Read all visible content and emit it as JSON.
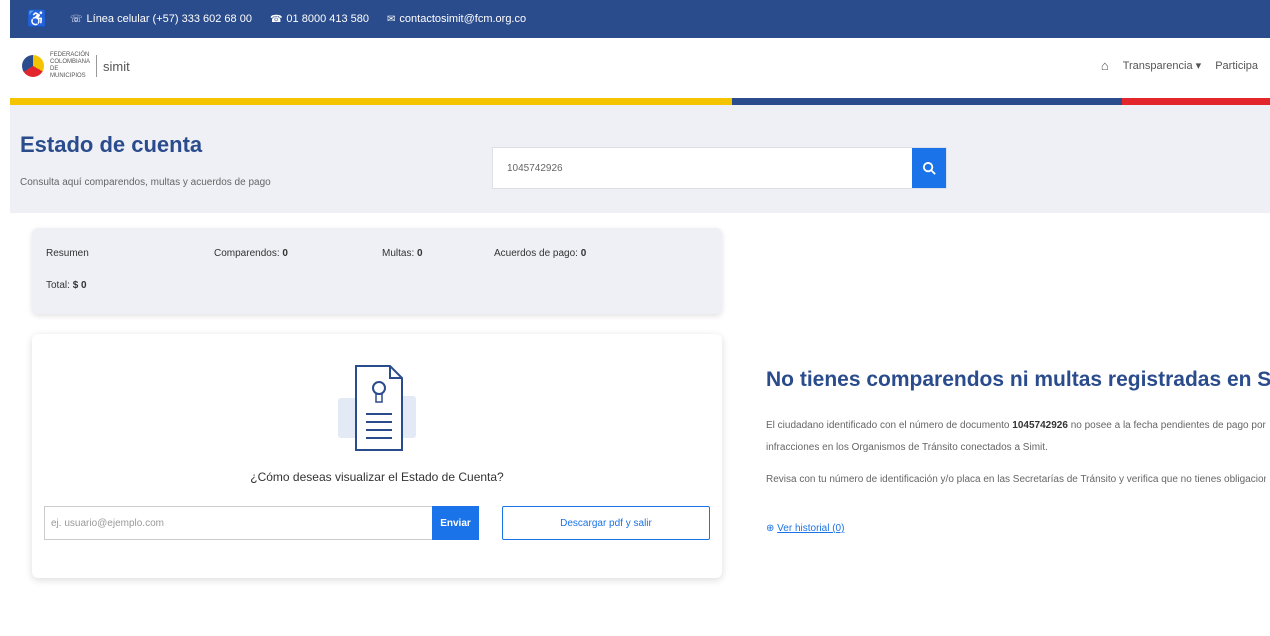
{
  "topbar": {
    "phone_label": "Línea celular (+57) 333 602 68 00",
    "landline": "01 8000 413 580",
    "email": "contactosimit@fcm.org.co"
  },
  "header": {
    "logo_text": "FEDERACIÓN COLOMBIANA DE MUNICIPIOS",
    "logo_app": "simit",
    "nav": [
      "Transparencia",
      "Participa"
    ]
  },
  "page": {
    "title": "Estado de cuenta",
    "subtitle": "Consulta aquí comparendos, multas y acuerdos de pago"
  },
  "search": {
    "value": "1045742926"
  },
  "summary": {
    "resumen_label": "Resumen",
    "comparendos_label": "Comparendos:",
    "comparendos_value": "0",
    "multas_label": "Multas:",
    "multas_value": "0",
    "acuerdos_label": "Acuerdos de pago:",
    "acuerdos_value": "0",
    "total_label": "Total:",
    "total_value": "$ 0"
  },
  "card": {
    "question": "¿Cómo deseas visualizar el Estado de Cuenta?",
    "email_placeholder": "ej. usuario@ejemplo.com",
    "send_label": "Enviar",
    "download_label": "Descargar pdf y salir"
  },
  "result": {
    "title": "No tienes comparendos ni multas registradas en Simit",
    "p1_before": "El ciudadano identificado con el número de documento",
    "document": "1045742926",
    "p1_after": "no posee a la fecha pendientes de pago por infracciones en los Organismos de Tránsito conectados a Simit.",
    "p2": "Revisa con tu número de identificación y/o placa en las Secretarías de Tránsito y verifica que no tienes obligaciones pendientes.",
    "history_link": "Ver historial (0)"
  },
  "colors": {
    "primary_blue": "#2b4c8c",
    "accent_blue": "#1a73e8",
    "flag_yellow": "#f5c400",
    "flag_red": "#e2262b"
  }
}
